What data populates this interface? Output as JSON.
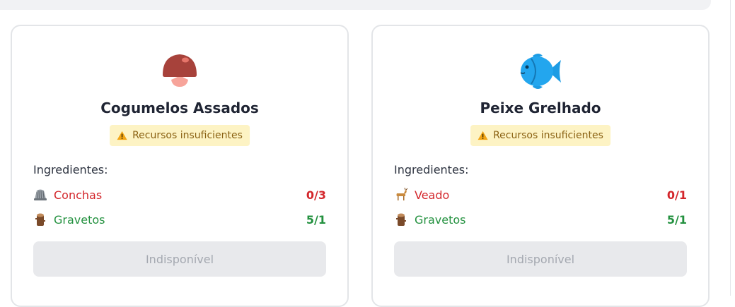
{
  "colors": {
    "insufficient": "#d3262b",
    "sufficient": "#23913f",
    "warning_bg": "#fdf3c4",
    "warning_text": "#8a6112",
    "disabled_bg": "#e8e9ec"
  },
  "recipes": [
    {
      "icon": "mushroom-icon",
      "name": "Cogumelos Assados",
      "status": "Recursos insuficientes",
      "ingredients_label": "Ingredientes:",
      "ingredients": [
        {
          "icon": "shell-icon",
          "name": "Conchas",
          "count": "0/3",
          "status": "insufficient"
        },
        {
          "icon": "wood-log-icon",
          "name": "Gravetos",
          "count": "5/1",
          "status": "sufficient"
        }
      ],
      "button_label": "Indisponível"
    },
    {
      "icon": "fish-icon",
      "name": "Peixe Grelhado",
      "status": "Recursos insuficientes",
      "ingredients_label": "Ingredientes:",
      "ingredients": [
        {
          "icon": "deer-icon",
          "name": "Veado",
          "count": "0/1",
          "status": "insufficient"
        },
        {
          "icon": "wood-log-icon",
          "name": "Gravetos",
          "count": "5/1",
          "status": "sufficient"
        }
      ],
      "button_label": "Indisponível"
    }
  ]
}
